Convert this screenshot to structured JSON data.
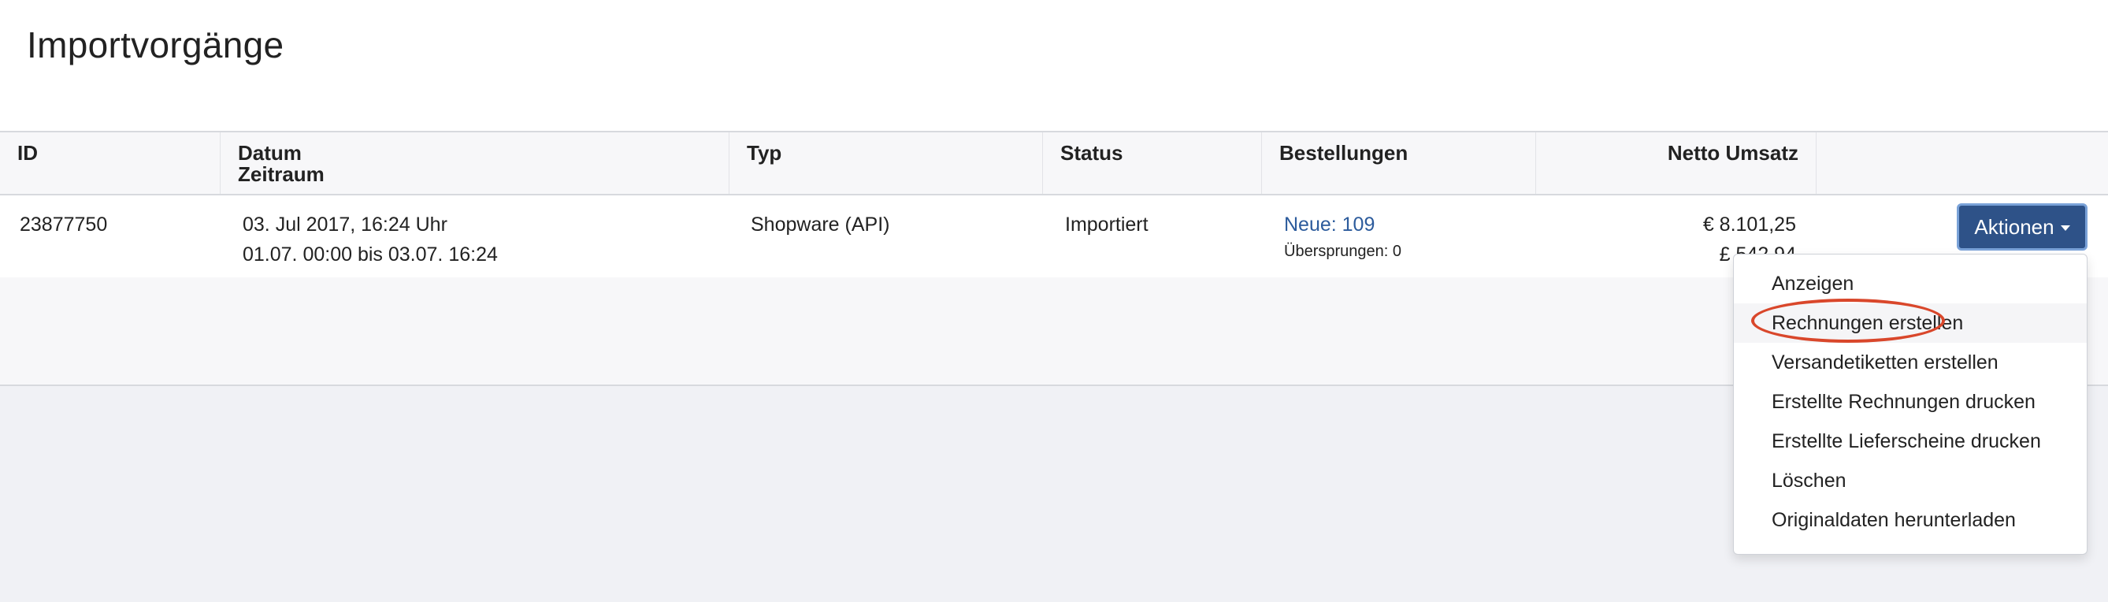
{
  "page": {
    "title": "Importvorgänge"
  },
  "table": {
    "headers": {
      "id": "ID",
      "datum": "Datum",
      "zeitraum": "Zeitraum",
      "typ": "Typ",
      "status": "Status",
      "bestellungen": "Bestellungen",
      "netto_umsatz": "Netto Umsatz"
    },
    "rows": [
      {
        "id": "23877750",
        "datum": "03. Jul 2017, 16:24 Uhr",
        "zeitraum": "01.07. 00:00 bis 03.07. 16:24",
        "typ": "Shopware (API)",
        "status": "Importiert",
        "neue": "Neue: 109",
        "uebersprungen": "Übersprungen: 0",
        "umsatz_eur": "€ 8.101,25",
        "umsatz_gbp": "£ 542,94"
      }
    ]
  },
  "actions": {
    "button_label": "Aktionen",
    "menu": [
      "Anzeigen",
      "Rechnungen erstellen",
      "Versandetiketten erstellen",
      "Erstellte Rechnungen drucken",
      "Erstellte Lieferscheine drucken",
      "Löschen",
      "Originaldaten herunterladen"
    ],
    "highlighted_item": "Rechnungen erstellen"
  },
  "colors": {
    "primary_button": "#2e5288",
    "link": "#2c5b9c",
    "highlight_ring": "#d9472b"
  }
}
